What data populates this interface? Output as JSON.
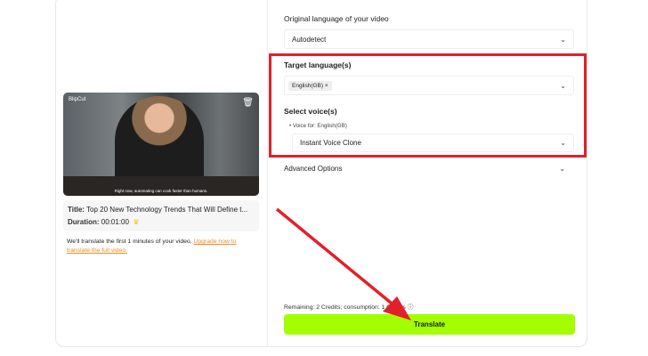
{
  "video": {
    "logo": "BlipCut",
    "subtitle": "Right now, automating can cook faster than humans."
  },
  "info": {
    "title_label": "Title:",
    "title_value": "Top 20 New Technology Trends That Will Define t...",
    "duration_label": "Duration:",
    "duration_value": "00:01:00",
    "crown": "♛"
  },
  "note": {
    "text": "We'll translate the first 1 minutes of your video. ",
    "link": "Upgrade now to translate the full video."
  },
  "form": {
    "original_label": "Original language of your video",
    "original_value": "Autodetect",
    "target_label": "Target language(s)",
    "target_tag": "English(GB)",
    "tag_remove": "×",
    "voice_label": "Select voice(s)",
    "voice_for": "Voice for: English(GB)",
    "voice_value": "Instant Voice Clone",
    "advanced_label": "Advanced Options",
    "credits": "Remaining: 2 Credits; consumption: 1 Credits",
    "translate": "Translate"
  },
  "colors": {
    "accent": "#a3ff00",
    "highlight": "#e2202a",
    "link": "#f08a24"
  }
}
